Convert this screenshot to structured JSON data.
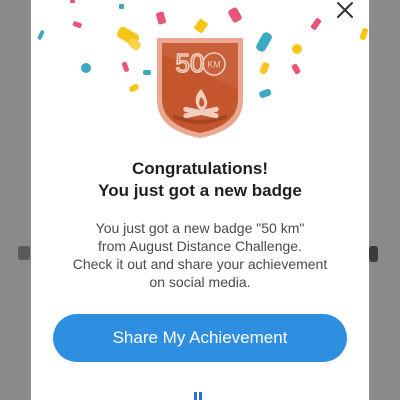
{
  "modal": {
    "title_line1": "Congratulations!",
    "title_line2": "You just got a new badge",
    "body_line1": "You just got a new badge \"50 km\"",
    "body_line2": "from August Distance Challenge.",
    "body_line3": "Check it out and share your achievement",
    "body_line4": "on social media.",
    "share_button_label": "Share My Achievement",
    "close_icon": "close-icon"
  },
  "badge": {
    "number": "50",
    "unit": "KM",
    "icon": "campfire-icon",
    "colors": {
      "border": "#e9a88f",
      "fill": "#c4562e",
      "dark": "#8e3a1c",
      "light": "#f3cdbd"
    }
  },
  "colors": {
    "accent": "#2e8fe0",
    "overlay": "#8a8a8a"
  }
}
